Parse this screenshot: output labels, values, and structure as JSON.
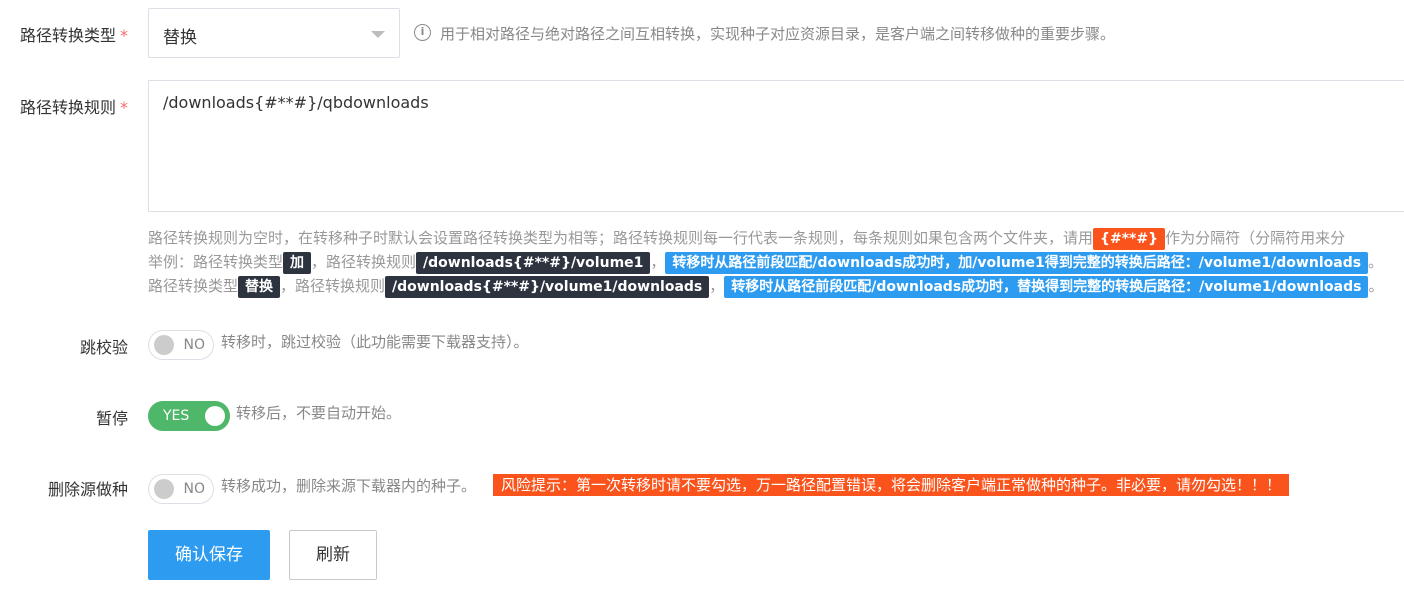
{
  "form": {
    "path_type": {
      "label": "路径转换类型",
      "required_mark": "*",
      "selected": "替换",
      "hint": "用于相对路径与绝对路径之间互相转换，实现种子对应资源目录，是客户端之间转移做种的重要步骤。"
    },
    "path_rules": {
      "label": "路径转换规则",
      "required_mark": "*",
      "value": "/downloads{#**#}/qbdownloads",
      "help": {
        "line1_text": "路径转换规则为空时，在转移种子时默认会设置路径转换类型为相等；路径转换规则每一行代表一条规则，每条规则如果包含两个文件夹，请用",
        "line1_sep": "{#**#}",
        "line1_tail": "作为分隔符（分隔符用来分",
        "line2_a": "举例：路径转换类型",
        "line2_chip_type": "加",
        "line2_b": "，路径转换规则",
        "line2_chip_rule": "/downloads{#**#}/volume1",
        "line2_c": "，",
        "line2_chip_result": "转移时从路径前段匹配/downloads成功时，加/volume1得到完整的转换后路径：/volume1/downloads",
        "line2_d": "。",
        "line3_a": "路径转换类型",
        "line3_chip_type": "替换",
        "line3_b": "，路径转换规则",
        "line3_chip_rule": "/downloads{#**#}/volume1/downloads",
        "line3_c": "，",
        "line3_chip_result": "转移时从路径前段匹配/downloads成功时，替换得到完整的转换后路径：/volume1/downloads",
        "line3_d": "。"
      }
    },
    "skip_check": {
      "label": "跳校验",
      "state": "NO",
      "hint": "转移时，跳过校验（此功能需要下载器支持）。"
    },
    "pause": {
      "label": "暂停",
      "state": "YES",
      "hint": "转移后，不要自动开始。"
    },
    "delete_source": {
      "label": "删除源做种",
      "state": "NO",
      "hint": "转移成功，删除来源下载器内的种子。",
      "risk": "风险提示：第一次转移时请不要勾选，万一路径配置错误，将会删除客户端正常做种的种子。非必要，请勿勾选！！！"
    }
  },
  "buttons": {
    "save": "确认保存",
    "refresh": "刷新"
  },
  "colors": {
    "primary": "#2d9cf0",
    "success": "#4fb769",
    "danger": "#fa541c",
    "dark_chip": "#2d3440",
    "required": "#f56c6c"
  }
}
